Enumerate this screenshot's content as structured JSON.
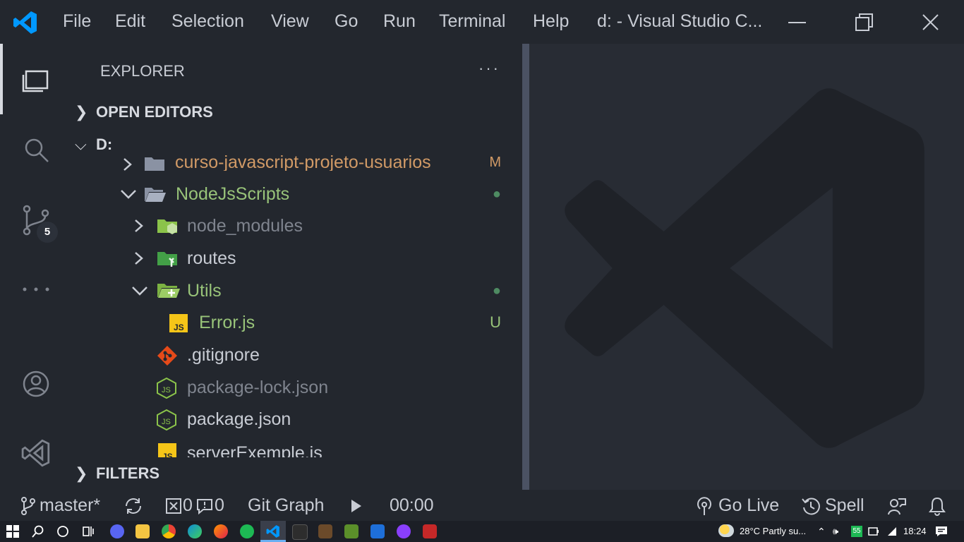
{
  "titlebar": {
    "menu": [
      "File",
      "Edit",
      "Selection",
      "View",
      "Go",
      "Run",
      "Terminal",
      "Help"
    ],
    "window_title": "d: - Visual Studio C..."
  },
  "activity": {
    "source_control_badge": "5"
  },
  "sidebar": {
    "title": "EXPLORER",
    "more": "···",
    "open_editors": "OPEN EDITORS",
    "root": "D:",
    "filters": "FILTERS",
    "tree": [
      {
        "name": "curso-javascript-projeto-usuarios",
        "deco": "M"
      },
      {
        "name": "NodeJsScripts",
        "deco": "●"
      },
      {
        "name": "node_modules",
        "deco": ""
      },
      {
        "name": "routes",
        "deco": ""
      },
      {
        "name": "Utils",
        "deco": "●"
      },
      {
        "name": "Error.js",
        "deco": "U"
      },
      {
        "name": ".gitignore",
        "deco": ""
      },
      {
        "name": "package-lock.json",
        "deco": ""
      },
      {
        "name": "package.json",
        "deco": ""
      },
      {
        "name": "serverExemple.js",
        "deco": ""
      }
    ]
  },
  "statusbar": {
    "branch": "master*",
    "errors": "0",
    "warnings": "0",
    "git_graph": "Git Graph",
    "timer": "00:00",
    "go_live": "Go Live",
    "spell": "Spell"
  },
  "taskbar": {
    "weather": "28°C  Partly su...",
    "battery_badge": "55",
    "time": "18:24"
  },
  "colors": {
    "green": "#98c379",
    "yellow_modified": "#d19a66",
    "dim": "#7f848e",
    "accent": "#0098ff"
  }
}
